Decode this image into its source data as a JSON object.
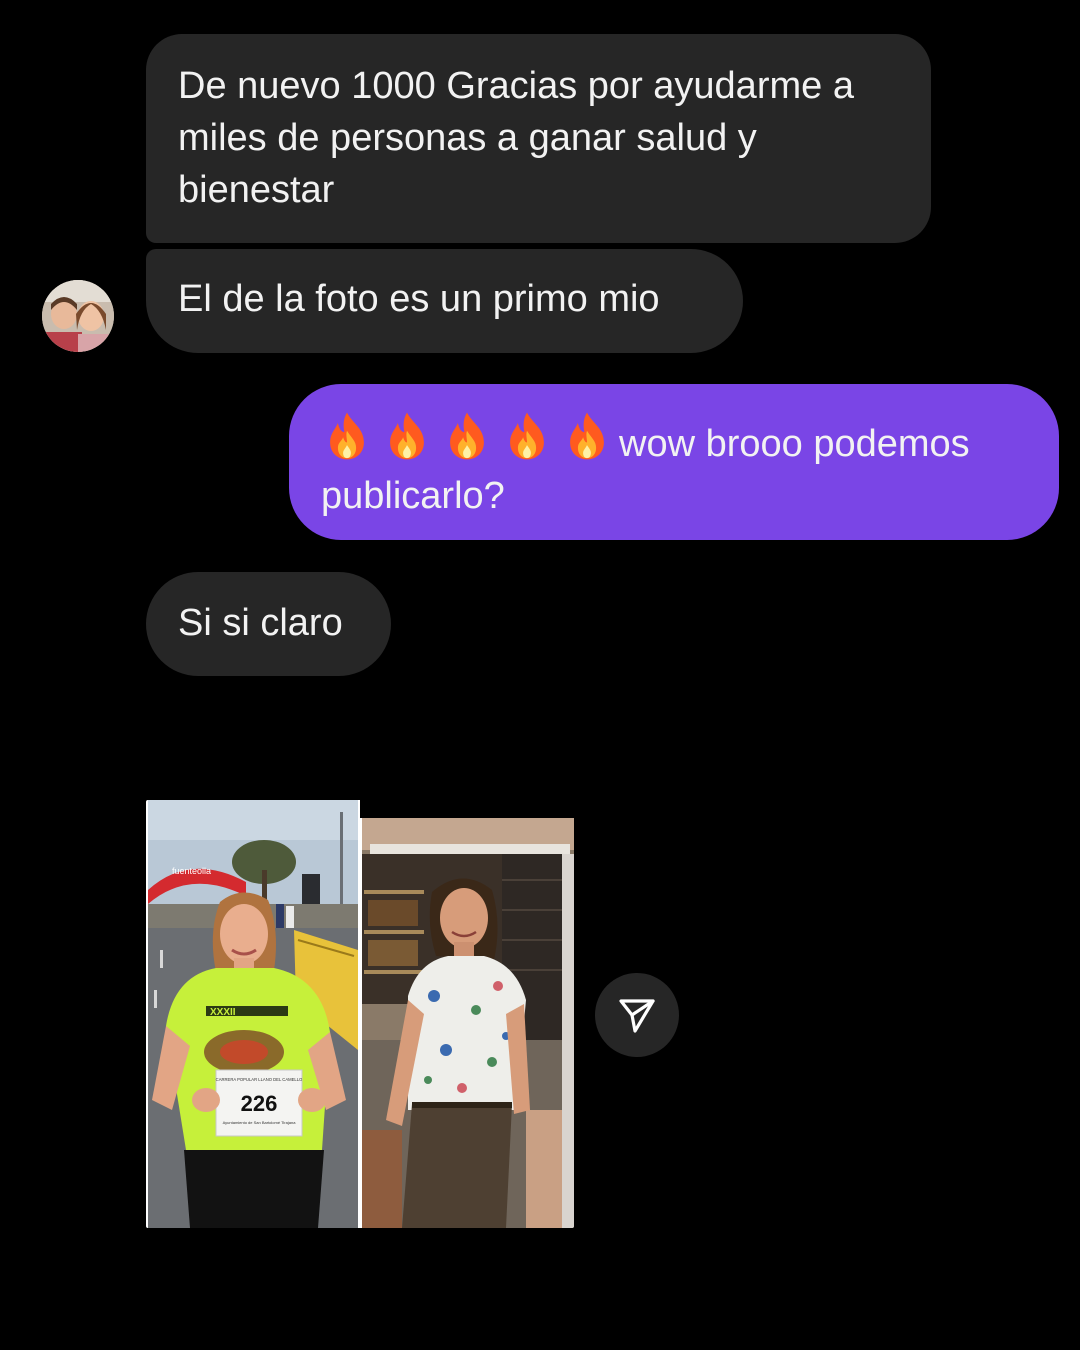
{
  "conversation": {
    "messages": [
      {
        "direction": "incoming",
        "text": "De nuevo 1000 Gracias por ayudarme a miles de personas a ganar salud y bienestar"
      },
      {
        "direction": "incoming",
        "text": "El de la foto es un primo mio"
      },
      {
        "direction": "outgoing",
        "emoji_count": 5,
        "emoji": "fire-icon",
        "text": "wow brooo podemos publicarlo?"
      },
      {
        "direction": "incoming",
        "text": "Si si claro"
      }
    ],
    "photo": {
      "bib_number": "226",
      "arch_text": "fuenteolla",
      "bib_caption_top": "CARRERA POPULAR LLANO DEL CAMELLO",
      "bib_caption_bottom": "Ayuntamiento de San Bartolomé Tirajana",
      "shirt_text": "XXXII"
    }
  },
  "colors": {
    "background": "#000000",
    "incoming_bubble": "#262626",
    "outgoing_bubble": "#7a45e6",
    "text": "#f2f2f2"
  },
  "icons": {
    "share": "paper-plane-icon",
    "reaction": "fire-icon"
  }
}
